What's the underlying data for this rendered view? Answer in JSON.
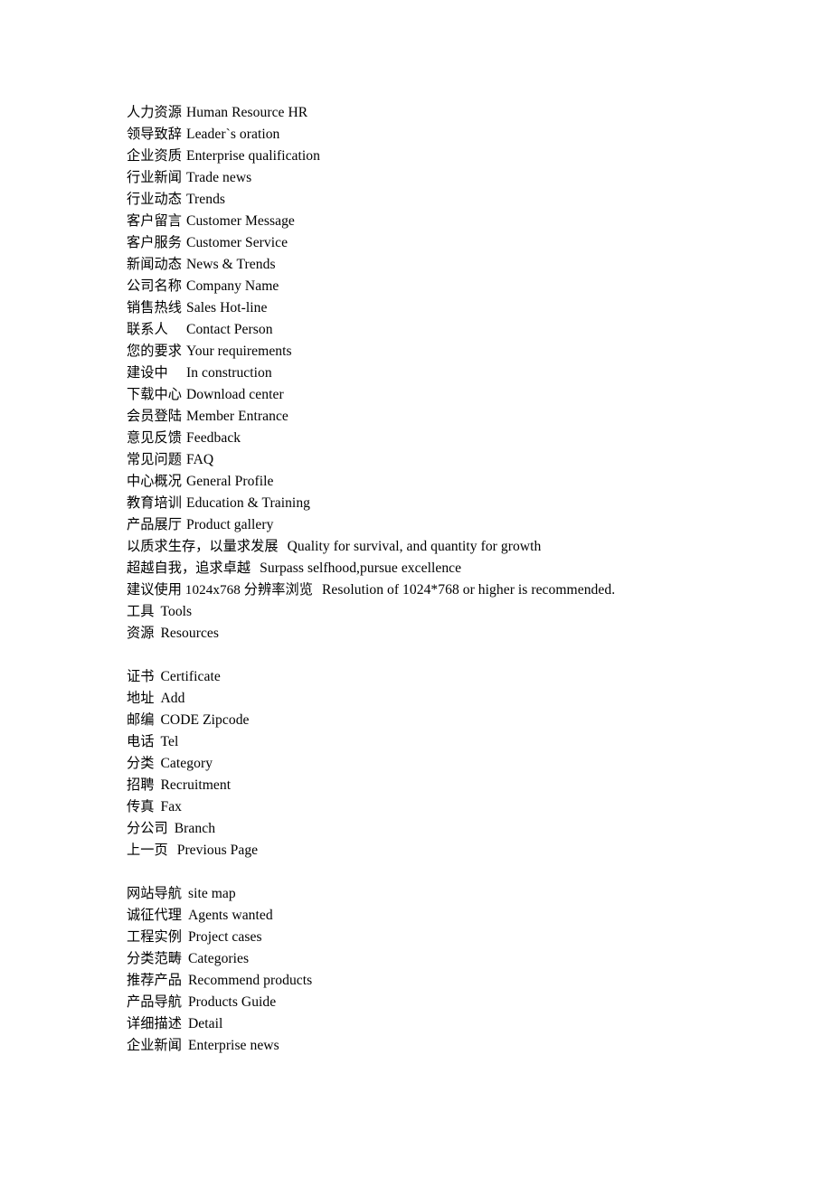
{
  "document": {
    "type": "bilingual-glossary",
    "language_pair": "Chinese-English",
    "blocks": [
      {
        "id": "block-1",
        "alignment": "tabbed",
        "entries": [
          {
            "term": "人力资源",
            "gloss": "Human Resource HR"
          },
          {
            "term": "领导致辞",
            "gloss": "Leader`s oration"
          },
          {
            "term": "企业资质",
            "gloss": "Enterprise qualification"
          },
          {
            "term": "行业新闻",
            "gloss": "Trade news"
          },
          {
            "term": "行业动态",
            "gloss": "Trends"
          },
          {
            "term": "客户留言",
            "gloss": "Customer Message"
          },
          {
            "term": "客户服务",
            "gloss": "Customer Service"
          },
          {
            "term": "新闻动态",
            "gloss": "News & Trends"
          },
          {
            "term": "公司名称",
            "gloss": "Company Name"
          },
          {
            "term": "销售热线",
            "gloss": "Sales Hot-line"
          },
          {
            "term": "联系人",
            "gloss": "Contact Person"
          },
          {
            "term": "您的要求",
            "gloss": "Your requirements"
          },
          {
            "term": "建设中",
            "gloss": "In construction"
          },
          {
            "term": "下载中心",
            "gloss": "Download center"
          },
          {
            "term": "会员登陆",
            "gloss": "Member Entrance"
          },
          {
            "term": "意见反馈",
            "gloss": "Feedback"
          },
          {
            "term": "常见问题",
            "gloss": "FAQ"
          },
          {
            "term": "中心概况",
            "gloss": "General Profile"
          },
          {
            "term": "教育培训",
            "gloss": "Education & Training"
          },
          {
            "term": "产品展厅",
            "gloss": "Product gallery"
          }
        ],
        "long_entries": [
          {
            "term": "以质求生存，以量求发展",
            "gloss": "Quality for survival, and quantity for growth"
          },
          {
            "term": "超越自我，追求卓越",
            "gloss": "Surpass selfhood,pursue excellence"
          },
          {
            "term": "建议使用 1024x768 分辨率浏览",
            "gloss": "Resolution of 1024*768 or higher is recommended."
          }
        ],
        "short_entries": [
          {
            "term": "工具",
            "gloss": "Tools"
          },
          {
            "term": "资源",
            "gloss": "Resources"
          }
        ]
      },
      {
        "id": "block-2",
        "alignment": "inline",
        "entries": [
          {
            "term": "证书",
            "gloss": "Certificate"
          },
          {
            "term": "地址",
            "gloss": "Add"
          },
          {
            "term": "邮编",
            "gloss": "CODE Zipcode"
          },
          {
            "term": "电话",
            "gloss": "Tel"
          },
          {
            "term": "分类",
            "gloss": "Category"
          },
          {
            "term": "招聘",
            "gloss": "Recruitment"
          },
          {
            "term": "传真",
            "gloss": "Fax"
          },
          {
            "term": "分公司",
            "gloss": "Branch"
          },
          {
            "term": "上一页",
            "gloss": "Previous Page"
          }
        ]
      },
      {
        "id": "block-3",
        "alignment": "inline",
        "entries": [
          {
            "term": "网站导航",
            "gloss": "site map"
          },
          {
            "term": "诚征代理",
            "gloss": "Agents wanted"
          },
          {
            "term": "工程实例",
            "gloss": "Project cases"
          },
          {
            "term": "分类范畴",
            "gloss": "Categories"
          },
          {
            "term": "推荐产品",
            "gloss": "Recommend products"
          },
          {
            "term": "产品导航",
            "gloss": "Products Guide"
          },
          {
            "term": "详细描述",
            "gloss": "Detail"
          },
          {
            "term": "企业新闻",
            "gloss": "Enterprise news"
          }
        ]
      }
    ]
  }
}
